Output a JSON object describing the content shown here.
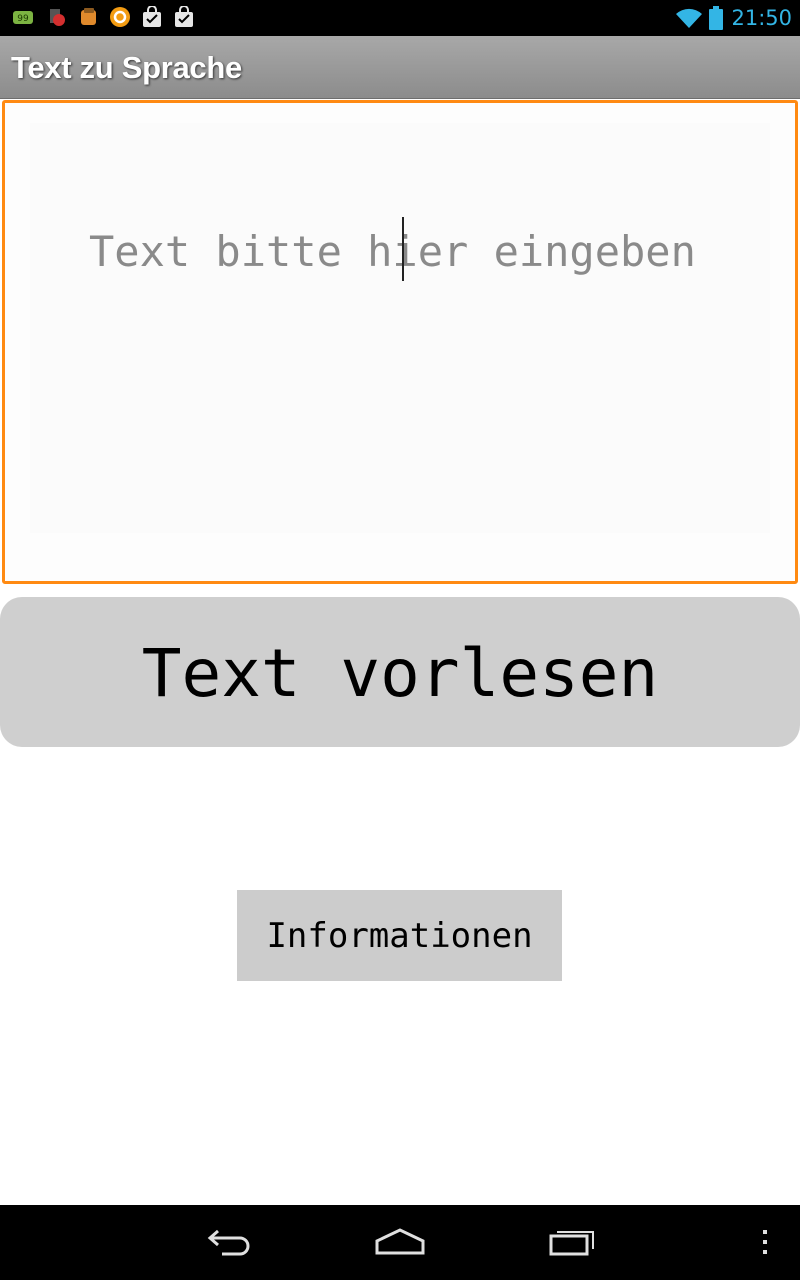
{
  "status_bar": {
    "time": "21:50",
    "notification_icons": [
      "badge-99-icon",
      "app-icon",
      "app-icon",
      "refresh-icon",
      "shopping-bag-icon",
      "shopping-bag-icon"
    ],
    "badge_text": "99",
    "clock_color": "#33b5e5"
  },
  "app": {
    "title": "Text zu Sprache"
  },
  "input": {
    "placeholder": "Text bitte hier eingeben",
    "value": "",
    "border_color": "#ff8a12"
  },
  "buttons": {
    "read_aloud": "Text vorlesen",
    "info": "Informationen"
  },
  "nav_bar": {
    "icons": [
      "back-icon",
      "home-icon",
      "recent-apps-icon",
      "overflow-menu-icon"
    ]
  }
}
